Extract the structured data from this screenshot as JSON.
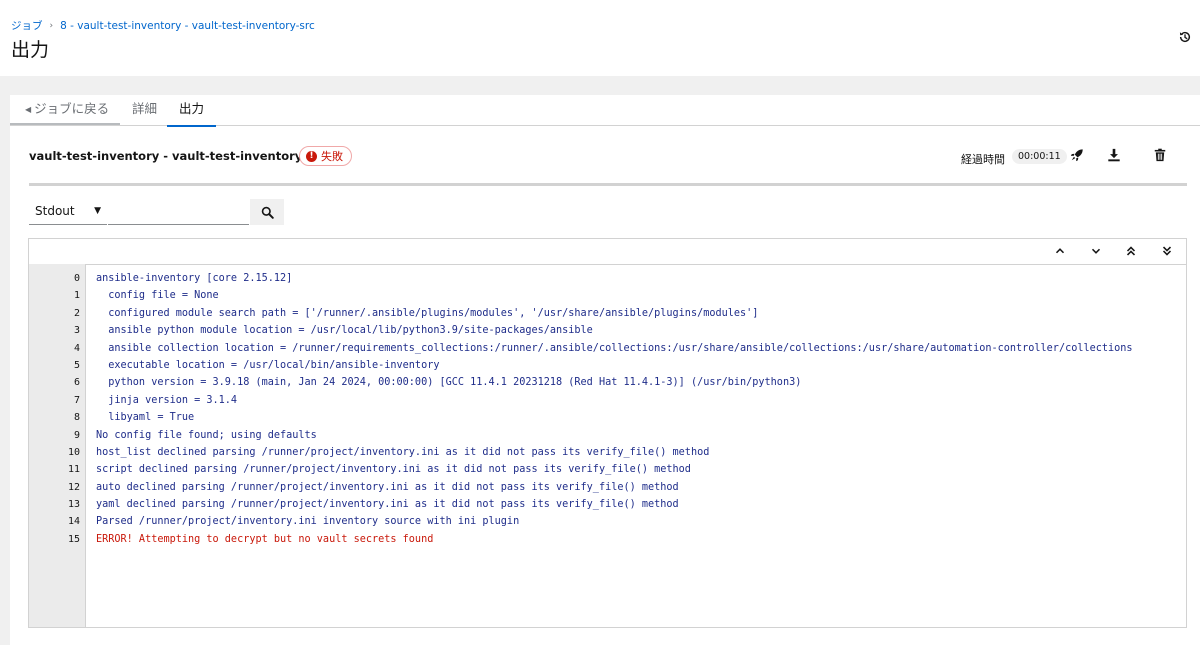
{
  "header": {
    "breadcrumb": {
      "root": "ジョブ",
      "separator": "›",
      "current": "8 - vault-test-inventory - vault-test-inventory-src"
    },
    "title": "出力"
  },
  "tabs": [
    {
      "label": "ジョブに戻る"
    },
    {
      "label": "詳細"
    },
    {
      "label": "出力"
    }
  ],
  "job": {
    "name": "vault-test-inventory - vault-test-inventory-src",
    "status": "失敗",
    "elapsed_label": "経過時間",
    "elapsed": "00:00:11"
  },
  "toolbar": {
    "stream_select": "Stdout",
    "search_value": "",
    "search_placeholder": ""
  },
  "colors": {
    "accent": "#0066cc",
    "error": "#c9190b",
    "log_text": "#1f2d8a"
  },
  "log": [
    {
      "num": "0",
      "text": "ansible-inventory [core 2.15.12]",
      "error": false
    },
    {
      "num": "1",
      "text": "  config file = None",
      "error": false
    },
    {
      "num": "2",
      "text": "  configured module search path = ['/runner/.ansible/plugins/modules', '/usr/share/ansible/plugins/modules']",
      "error": false
    },
    {
      "num": "3",
      "text": "  ansible python module location = /usr/local/lib/python3.9/site-packages/ansible",
      "error": false
    },
    {
      "num": "4",
      "text": "  ansible collection location = /runner/requirements_collections:/runner/.ansible/collections:/usr/share/ansible/collections:/usr/share/automation-controller/collections",
      "error": false
    },
    {
      "num": "5",
      "text": "  executable location = /usr/local/bin/ansible-inventory",
      "error": false
    },
    {
      "num": "6",
      "text": "  python version = 3.9.18 (main, Jan 24 2024, 00:00:00) [GCC 11.4.1 20231218 (Red Hat 11.4.1-3)] (/usr/bin/python3)",
      "error": false
    },
    {
      "num": "7",
      "text": "  jinja version = 3.1.4",
      "error": false
    },
    {
      "num": "8",
      "text": "  libyaml = True",
      "error": false
    },
    {
      "num": "9",
      "text": "No config file found; using defaults",
      "error": false
    },
    {
      "num": "10",
      "text": "host_list declined parsing /runner/project/inventory.ini as it did not pass its verify_file() method",
      "error": false
    },
    {
      "num": "11",
      "text": "script declined parsing /runner/project/inventory.ini as it did not pass its verify_file() method",
      "error": false
    },
    {
      "num": "12",
      "text": "auto declined parsing /runner/project/inventory.ini as it did not pass its verify_file() method",
      "error": false
    },
    {
      "num": "13",
      "text": "yaml declined parsing /runner/project/inventory.ini as it did not pass its verify_file() method",
      "error": false
    },
    {
      "num": "14",
      "text": "Parsed /runner/project/inventory.ini inventory source with ini plugin",
      "error": false
    },
    {
      "num": "15",
      "text": "ERROR! Attempting to decrypt but no vault secrets found",
      "error": true
    }
  ]
}
